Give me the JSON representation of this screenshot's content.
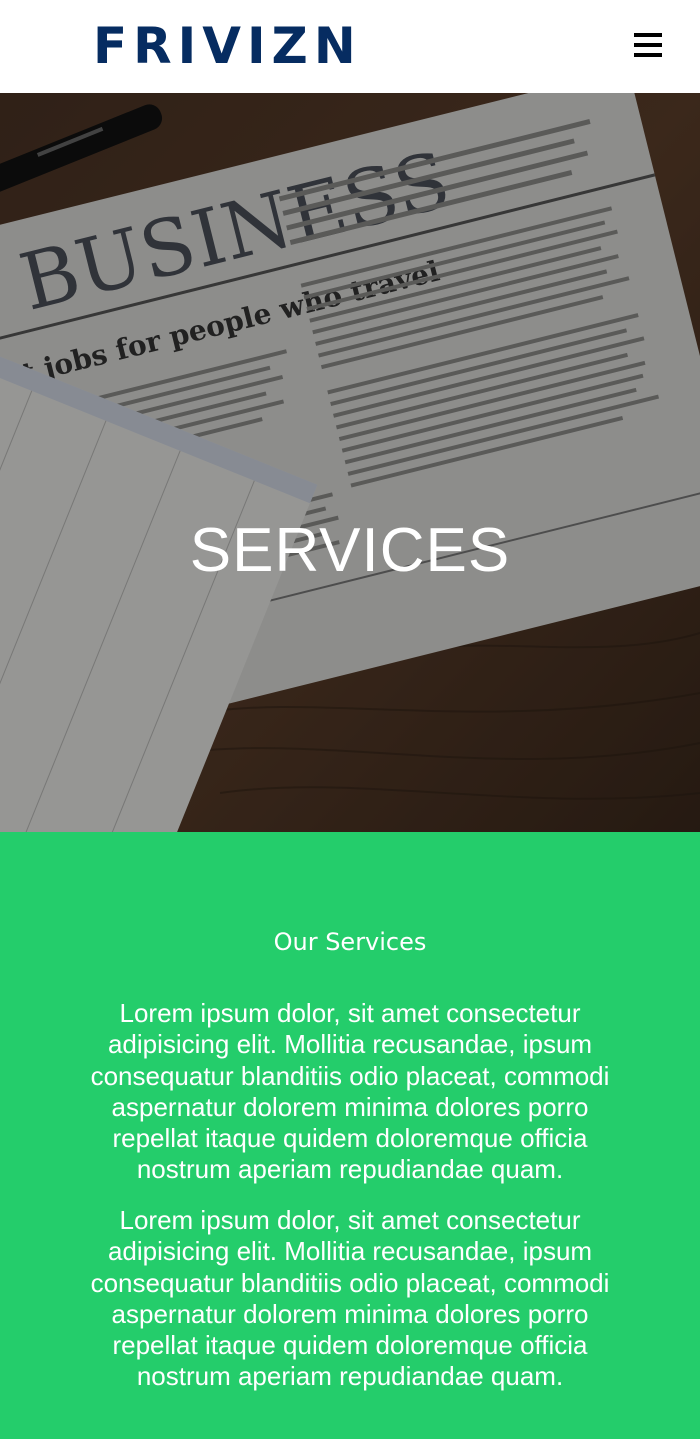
{
  "header": {
    "logo_text": "FRIVIZN",
    "menu_icon": "hamburger-menu-icon",
    "logo_color": "#062c61"
  },
  "hero": {
    "title": "SERVICES",
    "background_image": "newspaper-business-photo",
    "newspaper_headline": "BUSINESS",
    "newspaper_subheadline": "at jobs for people who travel"
  },
  "services": {
    "heading": "Our Services",
    "paragraphs": [
      "Lorem ipsum dolor, sit amet consectetur adipisicing elit. Mollitia recusandae, ipsum consequatur blanditiis odio placeat, commodi aspernatur dolorem minima dolores porro repellat itaque quidem doloremque officia nostrum aperiam repudiandae quam.",
      "Lorem ipsum dolor, sit amet consectetur adipisicing elit. Mollitia recusandae, ipsum consequatur blanditiis odio placeat, commodi aspernatur dolorem minima dolores porro repellat itaque quidem doloremque officia nostrum aperiam repudiandae quam."
    ],
    "background_color": "#24cd6b"
  }
}
